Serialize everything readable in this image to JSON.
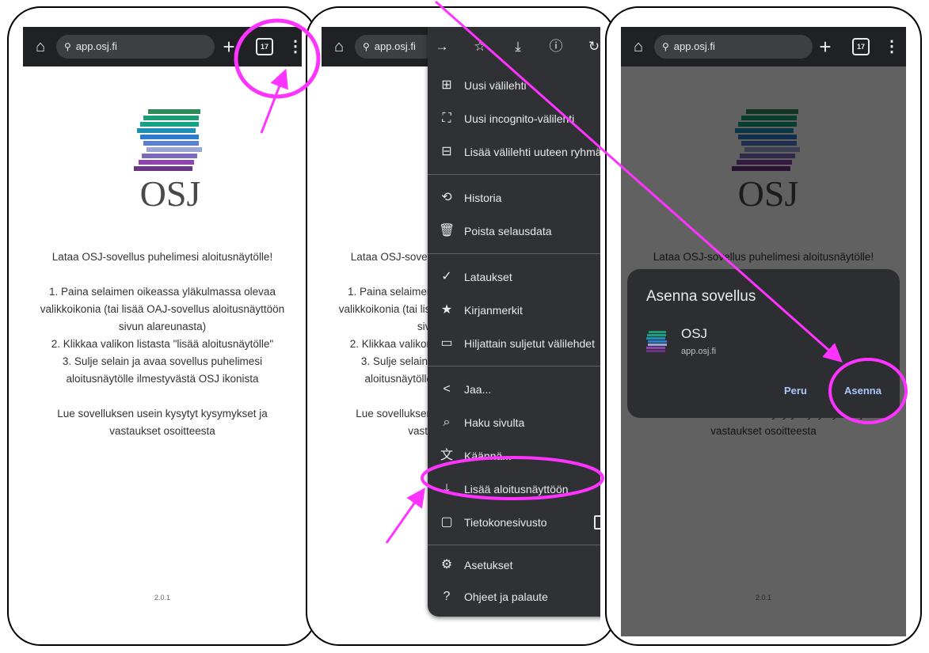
{
  "browser": {
    "url": "app.osj.fi",
    "tab_count": "17",
    "plus": "+",
    "menu_dots": "⋮",
    "home": "⌂"
  },
  "page": {
    "logo_text": "OSJ",
    "headline": "Lataa OSJ-sovellus puhelimesi aloitusnäytölle!",
    "instructions": [
      "1. Paina selaimen oikeassa yläkulmassa olevaa",
      "valikkoikonia (tai lisää OAJ-sovellus aloitusnäyttöön",
      "sivun alareunasta)",
      "2. Klikkaa valikon listasta \"lisää aloitusnäytölle\"",
      "3. Sulje selain ja avaa sovellus puhelimesi",
      "aloitusnäytölle ilmestyvästä OSJ ikonista"
    ],
    "faq": [
      "Lue sovelluksen usein kysytyt kysymykset ja",
      "vastaukset osoitteesta"
    ],
    "version": "2.0.1",
    "logo_colors": [
      "#2e8b57",
      "#1b9e77",
      "#16a085",
      "#1f8fb5",
      "#2b7bd0",
      "#5b7fcf",
      "#9aa5d6",
      "#7b6bb7",
      "#8e44ad",
      "#6c3483"
    ]
  },
  "menu": {
    "top_icons": [
      "forward-icon",
      "star-icon",
      "download-icon",
      "info-icon",
      "refresh-icon"
    ],
    "items": [
      {
        "icon": "⊞",
        "label": "Uusi välilehti"
      },
      {
        "icon": "⛶",
        "label": "Uusi incognito-välilehti"
      },
      {
        "icon": "⊟",
        "label": "Lisää välilehti uuteen ryhmään"
      },
      {
        "icon": "⟲",
        "label": "Historia"
      },
      {
        "icon": "🗑",
        "label": "Poista selausdata"
      },
      {
        "icon": "✓",
        "label": "Lataukset"
      },
      {
        "icon": "★",
        "label": "Kirjanmerkit"
      },
      {
        "icon": "▭",
        "label": "Hiljattain suljetut välilehdet"
      },
      {
        "icon": "<",
        "label": "Jaa..."
      },
      {
        "icon": "⌕",
        "label": "Haku sivulta"
      },
      {
        "icon": "文",
        "label": "Käännä..."
      },
      {
        "icon": "⤓",
        "label": "Lisää aloitusnäyttöön"
      },
      {
        "icon": "▢",
        "label": "Tietokonesivusto"
      },
      {
        "icon": "⚙",
        "label": "Asetukset"
      },
      {
        "icon": "?",
        "label": "Ohjeet ja palaute"
      }
    ]
  },
  "dialog": {
    "title": "Asenna sovellus",
    "app_name": "OSJ",
    "app_url": "app.osj.fi",
    "cancel": "Peru",
    "install": "Asenna"
  },
  "annotation_color": "#ff33ff"
}
